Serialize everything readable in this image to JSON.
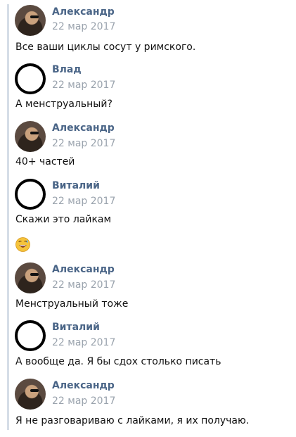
{
  "messages": [
    {
      "author": "Александр",
      "date": "22 мар 2017",
      "text": "Все ваши циклы сосут у римского.",
      "avatar": "photo"
    },
    {
      "author": "Влад",
      "date": "22 мар 2017",
      "text": "А менструальный?",
      "avatar": "empty"
    },
    {
      "author": "Александр",
      "date": "22 мар 2017",
      "text": "40+ частей",
      "avatar": "photo"
    },
    {
      "author": "Виталий",
      "date": "22 мар 2017",
      "text": "Скажи это лайкам",
      "emoji": "grinning-face-sweat",
      "avatar": "empty"
    },
    {
      "author": "Александр",
      "date": "22 мар 2017",
      "text": "Менструальный тоже",
      "avatar": "photo"
    },
    {
      "author": "Виталий",
      "date": "22 мар 2017",
      "text": "А вообще да. Я бы сдох столько писать",
      "avatar": "empty"
    },
    {
      "author": "Александр",
      "date": "22 мар 2017",
      "text": "Я не разговариваю с лайками, я их получаю.",
      "avatar": "photo"
    }
  ]
}
